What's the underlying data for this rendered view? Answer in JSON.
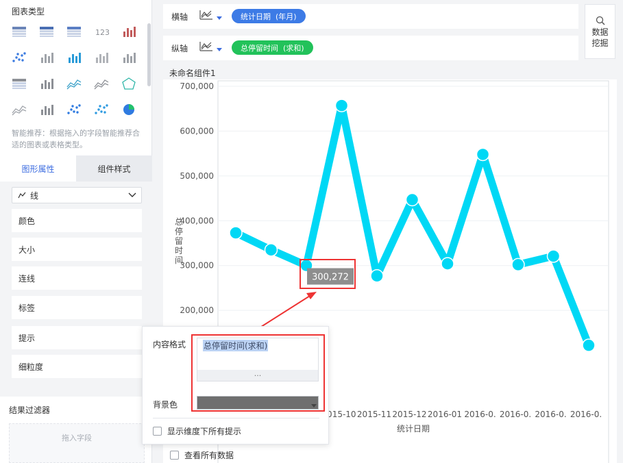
{
  "left_panel": {
    "chart_types_title": "图表类型",
    "chart_type_icons": [
      "table-icon",
      "cross-table-icon",
      "detail-table-icon",
      "kpi-number-icon",
      "grid-number-icon",
      "dot-legend-icon",
      "map-icon",
      "bar-column-icon",
      "column-icon",
      "column-sort-icon",
      "heat-table-icon",
      "step-column-icon",
      "multi-line-icon",
      "line-chart-icon",
      "radar-icon",
      "area-icon",
      "bar-grouped-icon",
      "scatter-icon",
      "ring-dots-icon",
      "pie-icon"
    ],
    "smart_tip": "智能推荐：根据拖入的字段智能推荐合适的图表或表格类型。",
    "tabs": [
      "图形属性",
      "组件样式"
    ],
    "line_select_label": "线",
    "property_items": [
      "颜色",
      "大小",
      "连线",
      "标签",
      "提示",
      "细粒度"
    ],
    "filter_title": "结果过滤器",
    "drop_placeholder": "拖入字段"
  },
  "axes": {
    "x": {
      "name": "横轴",
      "field": "统计日期  (年月)",
      "color": "#3d7be6"
    },
    "y": {
      "name": "纵轴",
      "field": "总停留时间  (求和)",
      "color": "#22c25a"
    }
  },
  "data_mining_label": "数据挖掘",
  "component_name": "未命名组件1",
  "chart_data": {
    "type": "line",
    "ylabel": "总停留时间",
    "xlabel": "统计日期",
    "ylim": [
      0,
      700000
    ],
    "y_ticks": [
      "200,000",
      "300,000",
      "400,000",
      "500,000",
      "600,000",
      "700,000"
    ],
    "x_ticks_visible": [
      "2015-10",
      "2015-11",
      "2015-12",
      "2016-01",
      "2016-0.",
      "2016-0.",
      "2016-0.",
      "2016-0."
    ],
    "series": [
      {
        "values": [
          373000,
          335000,
          300272,
          657000,
          277000,
          447000,
          304000,
          548000,
          302000,
          321000,
          122000
        ]
      }
    ],
    "color": "#00d8f5",
    "highlight_label": "300,272"
  },
  "tooltip_popup": {
    "content_format_label": "内容格式",
    "content_format_value": "总停留时间(求和)",
    "more": "...",
    "bg_color_label": "背景色",
    "bg_color": "#6f6f6f",
    "show_all_tips_label": "显示维度下所有提示"
  },
  "view_all_data_label": "查看所有数据"
}
